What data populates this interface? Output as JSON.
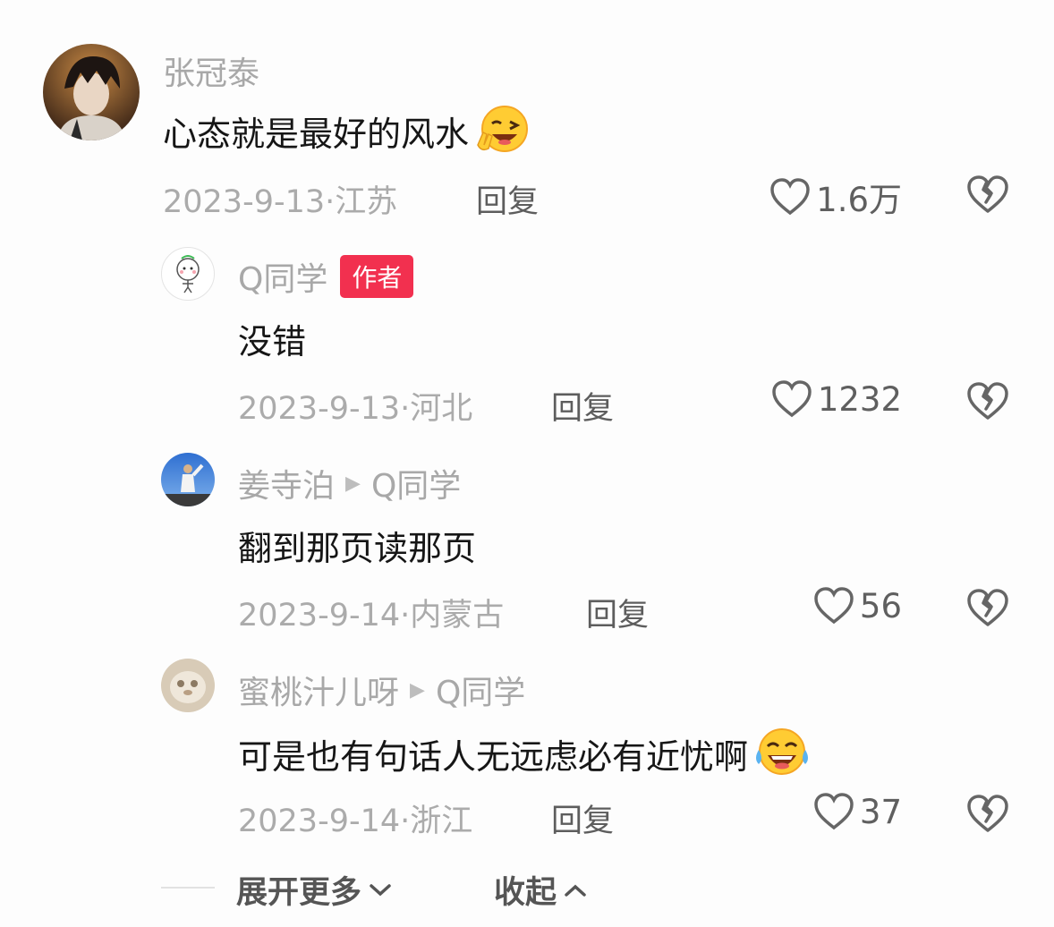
{
  "comments": [
    {
      "username": "张冠泰",
      "text": "心态就是最好的风水",
      "emoji": "squinting-wink-peace-emoji",
      "date": "2023-9-13",
      "location": "江苏",
      "reply_label": "回复",
      "likes": "1.6万"
    },
    {
      "username": "Q同学",
      "badge": "作者",
      "text": "没错",
      "date": "2023-9-13",
      "location": "河北",
      "reply_label": "回复",
      "likes": "1232"
    },
    {
      "username": "姜寺泊",
      "reply_to": "Q同学",
      "text": "翻到那页读那页",
      "date": "2023-9-14",
      "location": "内蒙古",
      "reply_label": "回复",
      "likes": "56"
    },
    {
      "username": "蜜桃汁儿呀",
      "reply_to": "Q同学",
      "text": "可是也有句话人无远虑必有近忧啊",
      "emoji": "tears-of-joy-emoji",
      "date": "2023-9-14",
      "location": "浙江",
      "reply_label": "回复",
      "likes": "37"
    }
  ],
  "footer": {
    "expand_label": "展开更多",
    "collapse_label": "收起"
  },
  "colors": {
    "badge": "#f2304f",
    "text_primary": "#161616",
    "text_secondary": "#a8a8a8"
  }
}
